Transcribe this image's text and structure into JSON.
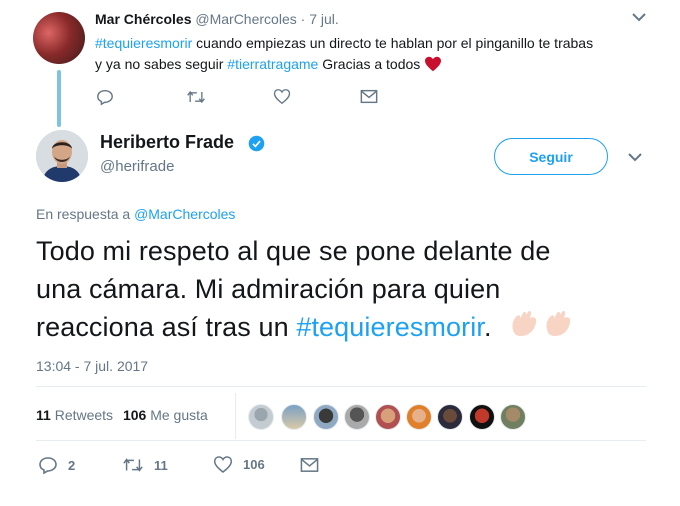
{
  "parent_tweet": {
    "name": "Mar Chércoles",
    "handle": "@MarChercoles",
    "sep": "·",
    "date": "7 jul.",
    "text": {
      "hashtag1": "#tequieresmorir",
      "part1": " cuando empiezas un directo te hablan por el pinganillo te trabas",
      "part2": "y ya no sabes seguir ",
      "hashtag2": "#tierratragame",
      "part3": " Gracias a todos"
    },
    "icons": [
      "reply-icon",
      "retweet-icon",
      "like-icon",
      "message-icon",
      "caret-down-icon",
      "heart-emoji-icon"
    ]
  },
  "main_tweet": {
    "name": "Heriberto Frade",
    "handle": "@herifrade",
    "verified": true,
    "follow_label": "Seguir",
    "reply_prefix": "En respuesta a ",
    "reply_handle": "@MarChercoles",
    "text": {
      "line1": "Todo mi respeto al que se pone delante de",
      "line2": "una cámara. Mi admiración para quien",
      "line3": "reacciona así tras un ",
      "hashtag": "#tequieresmorir",
      "end": "."
    },
    "timestamp": "13:04 - 7 jul. 2017",
    "stats": {
      "retweets_count": "11",
      "retweets_label": "Retweets",
      "likes_count": "106",
      "likes_label": "Me gusta"
    },
    "actions": {
      "reply_count": "2",
      "retweet_count": "11",
      "like_count": "106"
    }
  },
  "colors": {
    "link": "#1da1f2",
    "muted": "#657786",
    "heart": "#e0245e",
    "thread_line": "#7fc4de"
  }
}
